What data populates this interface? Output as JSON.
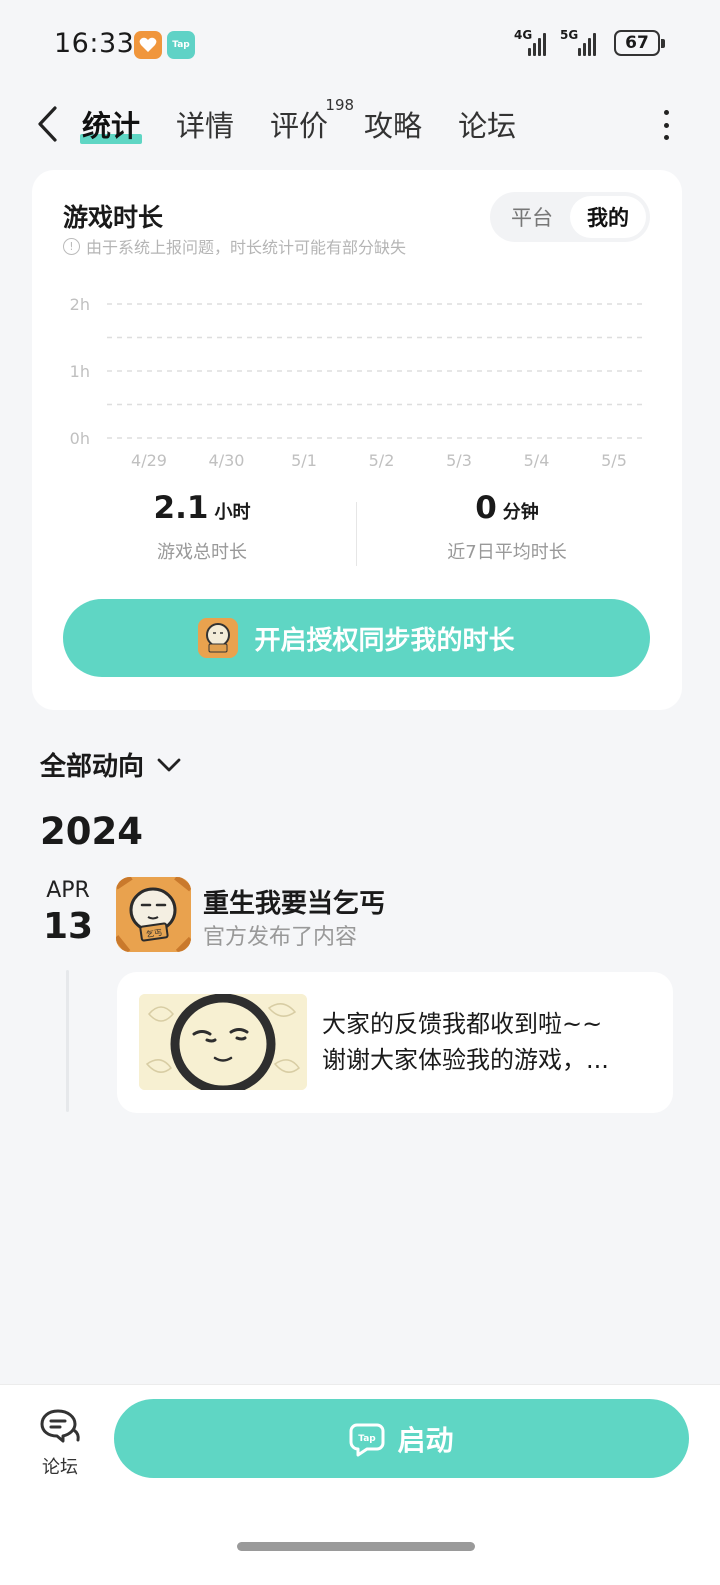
{
  "status_bar": {
    "time": "16:33",
    "tap_badge": "Tap",
    "network_1": "4G",
    "network_2": "5G",
    "battery": "67"
  },
  "nav": {
    "tabs": [
      {
        "label": "统计",
        "active": true
      },
      {
        "label": "详情"
      },
      {
        "label": "评价",
        "badge": "198"
      },
      {
        "label": "攻略"
      },
      {
        "label": "论坛"
      }
    ]
  },
  "stats_card": {
    "title": "游戏时长",
    "note": "由于系统上报问题，时长统计可能有部分缺失",
    "toggle": {
      "options": [
        "平台",
        "我的"
      ],
      "selected": "我的"
    },
    "total": {
      "value": "2.1",
      "unit": "小时",
      "label": "游戏总时长"
    },
    "average": {
      "value": "0",
      "unit": "分钟",
      "label": "近7日平均时长"
    },
    "sync_button": "开启授权同步我的时长"
  },
  "chart_data": {
    "type": "bar",
    "categories": [
      "4/29",
      "4/30",
      "5/1",
      "5/2",
      "5/3",
      "5/4",
      "5/5"
    ],
    "values": [
      0,
      0,
      0,
      0,
      0,
      0,
      0
    ],
    "y_ticks": [
      "0h",
      "1h",
      "2h"
    ],
    "ylim": [
      0,
      2
    ],
    "grid": true
  },
  "activity": {
    "filter_label": "全部动向",
    "year": "2024",
    "entry": {
      "month": "APR",
      "day": "13",
      "game_name": "重生我要当乞丐",
      "action": "官方发布了内容",
      "icon_text": "乞丐",
      "post_lines": [
        "大家的反馈我都收到啦~~",
        "谢谢大家体验我的游戏，..."
      ]
    }
  },
  "bottom_bar": {
    "forum_label": "论坛",
    "launch_label": "启动",
    "launch_icon_text": "Tap"
  },
  "colors": {
    "accent": "#5fd6c4",
    "background": "#f5f6f8",
    "card": "#ffffff",
    "muted_text": "#999999"
  }
}
